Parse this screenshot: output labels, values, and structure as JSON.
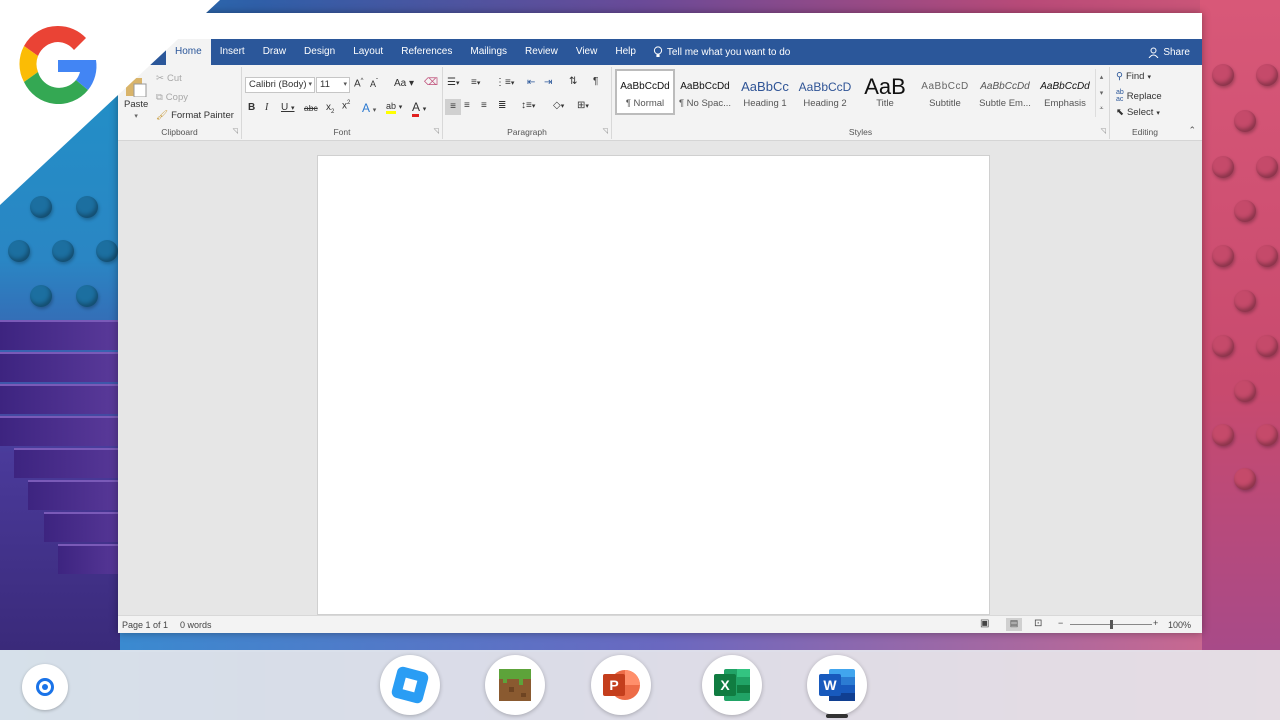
{
  "window": {
    "menu_tabs": [
      "Home",
      "Insert",
      "Draw",
      "Design",
      "Layout",
      "References",
      "Mailings",
      "Review",
      "View",
      "Help"
    ],
    "tell_me": "Tell me what you want to do",
    "share": "Share"
  },
  "ribbon": {
    "clipboard": {
      "paste": "Paste",
      "cut": "Cut",
      "copy": "Copy",
      "format_painter": "Format Painter",
      "label": "Clipboard"
    },
    "font": {
      "family": "Calibri (Body)",
      "size": "11",
      "label": "Font",
      "change_case": "Aa"
    },
    "paragraph": {
      "label": "Paragraph"
    },
    "styles": {
      "label": "Styles",
      "items": [
        {
          "preview": "AaBbCcDd",
          "name": "¶ Normal"
        },
        {
          "preview": "AaBbCcDd",
          "name": "¶ No Spac..."
        },
        {
          "preview": "AaBbCc",
          "name": "Heading 1"
        },
        {
          "preview": "AaBbCcD",
          "name": "Heading 2"
        },
        {
          "preview": "AaB",
          "name": "Title"
        },
        {
          "preview": "AaBbCcD",
          "name": "Subtitle"
        },
        {
          "preview": "AaBbCcDd",
          "name": "Subtle Em..."
        },
        {
          "preview": "AaBbCcDd",
          "name": "Emphasis"
        }
      ]
    },
    "editing": {
      "find": "Find",
      "replace": "Replace",
      "select": "Select",
      "label": "Editing"
    }
  },
  "status": {
    "page": "Page 1 of 1",
    "words": "0 words",
    "zoom": "100%",
    "zoom_minus": "−",
    "zoom_plus": "+",
    "zoom_level": 1.0
  },
  "taskbar": {
    "apps": [
      "roblox",
      "minecraft",
      "powerpoint",
      "excel",
      "word"
    ],
    "active_app": "word",
    "accent": "#2b579a"
  }
}
